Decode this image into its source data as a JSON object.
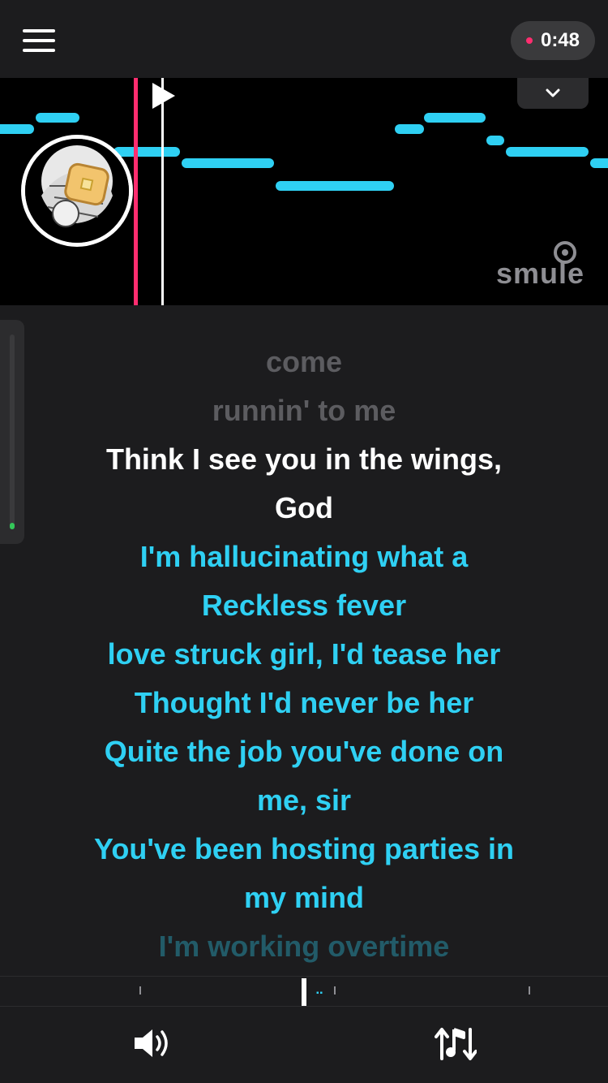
{
  "header": {
    "menu_icon": "hamburger-menu-icon",
    "timer": "0:48",
    "recording_color": "#ff2d6f"
  },
  "pitch_guide": {
    "note_color": "#2fd0f3",
    "playhead_color": "#ff2d6f",
    "brand": "smule"
  },
  "lyrics": {
    "past": [
      "come",
      "runnin' to me"
    ],
    "current": [
      "Think I see you in the wings,",
      "God"
    ],
    "upcoming": [
      "I'm hallucinating what a",
      "Reckless fever",
      "love struck girl, I'd tease her",
      "Thought I'd never be her",
      "Quite the job you've done on",
      "me, sir",
      "You've been hosting parties in",
      "my mind",
      "I'm working overtime"
    ]
  },
  "controls": {
    "volume_icon": "speaker-volume-icon",
    "pitch_icon": "pitch-adjust-icon"
  }
}
